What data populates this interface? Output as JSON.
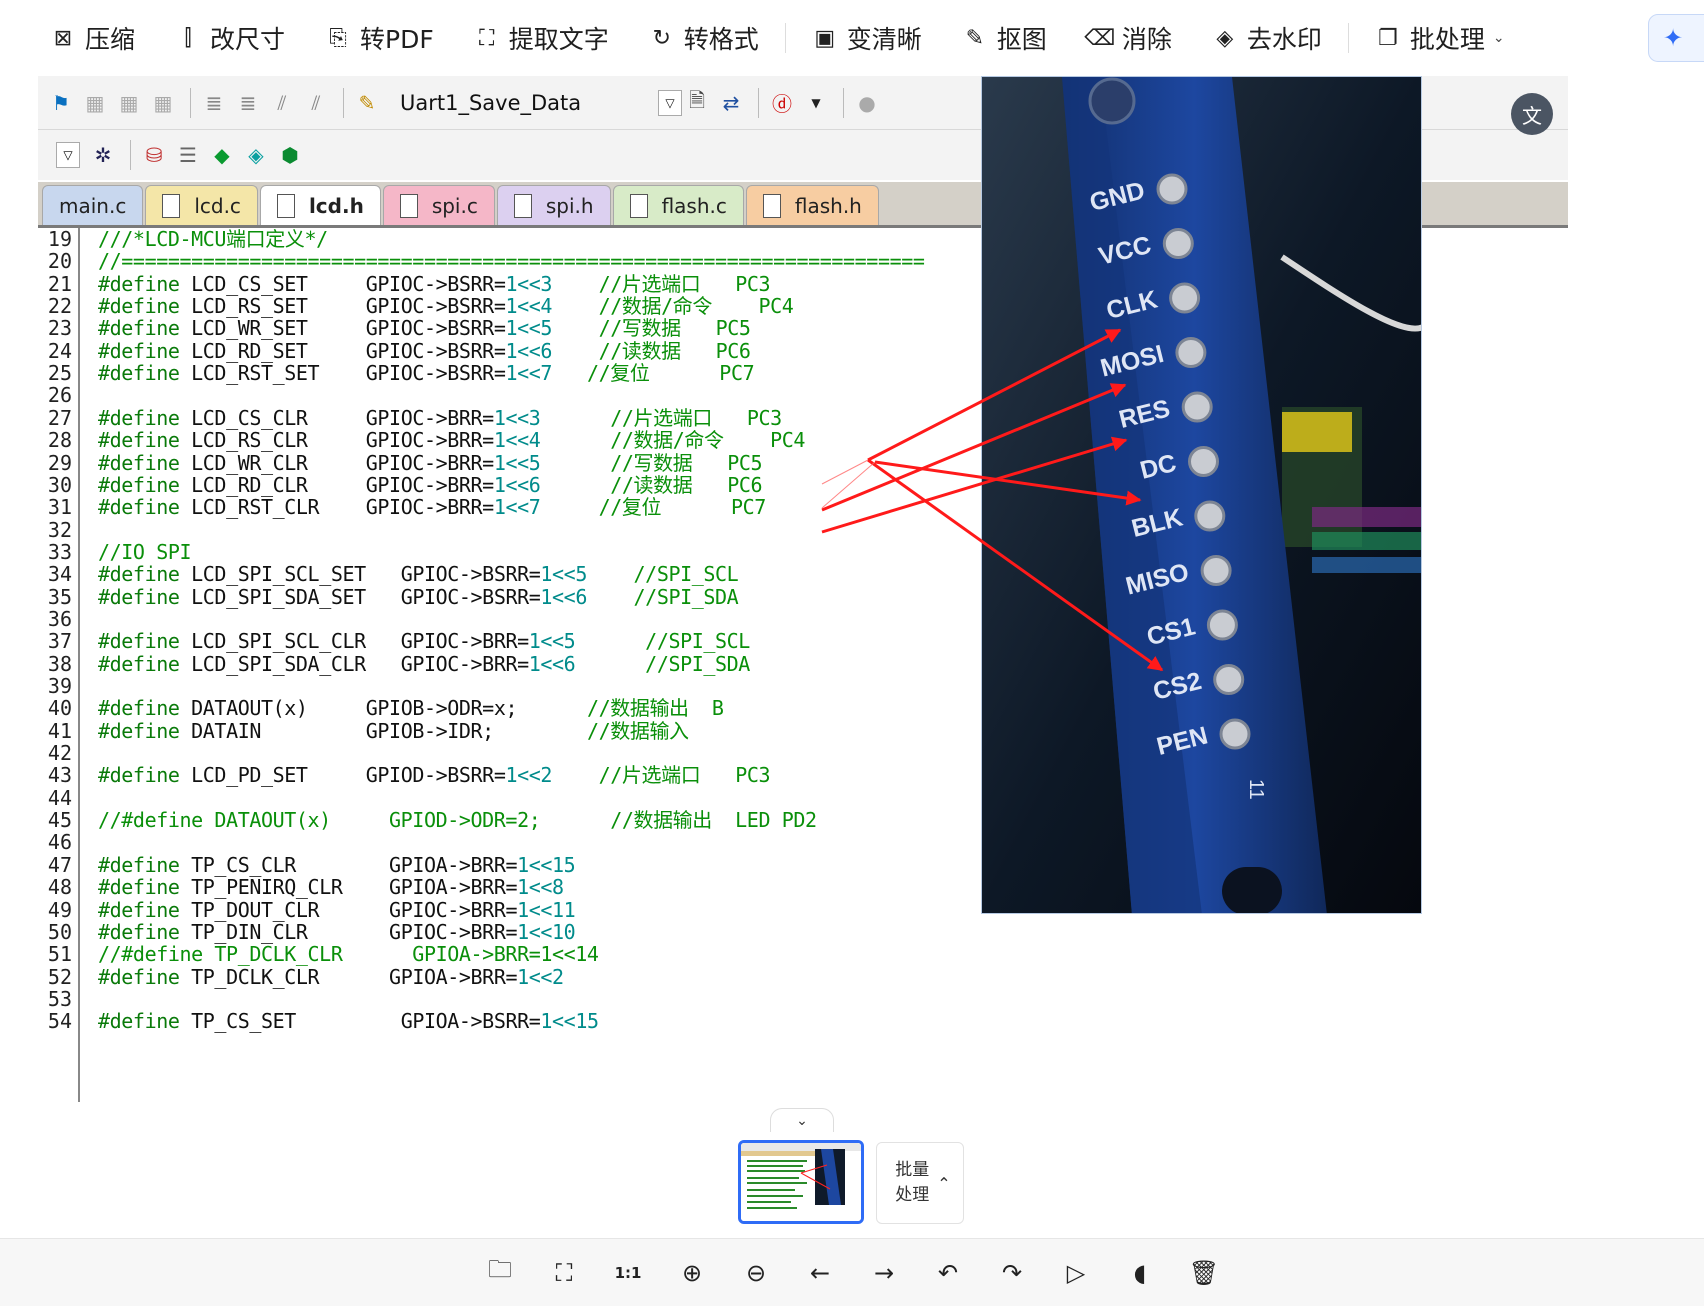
{
  "toolbar": {
    "items": [
      {
        "label": "压缩",
        "icon": "compress-icon",
        "glyph": "⊠"
      },
      {
        "label": "改尺寸",
        "icon": "resize-icon",
        "glyph": "⫿"
      },
      {
        "label": "转PDF",
        "icon": "pdf-icon",
        "glyph": "⎘"
      },
      {
        "label": "提取文字",
        "icon": "ocr-icon",
        "glyph": "⛶"
      },
      {
        "label": "转格式",
        "icon": "convert-format-icon",
        "glyph": "↻"
      },
      {
        "label": "变清晰",
        "icon": "hd-icon",
        "glyph": "▣"
      },
      {
        "label": "抠图",
        "icon": "cutout-icon",
        "glyph": "✎"
      },
      {
        "label": "消除",
        "icon": "erase-icon",
        "glyph": "⌫"
      },
      {
        "label": "去水印",
        "icon": "watermark-icon",
        "glyph": "◈"
      },
      {
        "label": "批处理",
        "icon": "batch-icon",
        "glyph": "❐"
      }
    ],
    "ai_glyph": "✦"
  },
  "ide": {
    "target_combo": "Uart1_Save_Data",
    "tabs": [
      {
        "label": "main.c",
        "color": "#c8d7ee",
        "doc": false
      },
      {
        "label": "lcd.c",
        "color": "#f4e6a8",
        "doc": true
      },
      {
        "label": "lcd.h",
        "color": "#ffffff",
        "doc": true,
        "active": true
      },
      {
        "label": "spi.c",
        "color": "#f5b7c8",
        "doc": true
      },
      {
        "label": "spi.h",
        "color": "#dcd0f0",
        "doc": true
      },
      {
        "label": "flash.c",
        "color": "#d8ebc8",
        "doc": true
      },
      {
        "label": "flash.h",
        "color": "#f7cda2",
        "doc": true
      }
    ],
    "lines": [
      {
        "n": "19",
        "t": "///*LCD-MCU端口定义*/",
        "cls": "cm"
      },
      {
        "n": "20",
        "t": "//=====================================================================",
        "cls": "cm"
      },
      {
        "n": "21",
        "k": "#define",
        "a": " LCD_CS_SET     ",
        "b": "GPIOC->BSRR=",
        "c": "1<<3",
        "d": "    //片选端口   PC3"
      },
      {
        "n": "22",
        "k": "#define",
        "a": " LCD_RS_SET     ",
        "b": "GPIOC->BSRR=",
        "c": "1<<4",
        "d": "    //数据/命令    PC4"
      },
      {
        "n": "23",
        "k": "#define",
        "a": " LCD_WR_SET     ",
        "b": "GPIOC->BSRR=",
        "c": "1<<5",
        "d": "    //写数据   PC5"
      },
      {
        "n": "24",
        "k": "#define",
        "a": " LCD_RD_SET     ",
        "b": "GPIOC->BSRR=",
        "c": "1<<6",
        "d": "    //读数据   PC6"
      },
      {
        "n": "25",
        "k": "#define",
        "a": " LCD_RST_SET    ",
        "b": "GPIOC->BSRR=",
        "c": "1<<7",
        "d": "   //复位      PC7"
      },
      {
        "n": "26",
        "t": ""
      },
      {
        "n": "27",
        "k": "#define",
        "a": " LCD_CS_CLR     ",
        "b": "GPIOC->BRR=",
        "c": "1<<3",
        "d": "      //片选端口   PC3"
      },
      {
        "n": "28",
        "k": "#define",
        "a": " LCD_RS_CLR     ",
        "b": "GPIOC->BRR=",
        "c": "1<<4",
        "d": "      //数据/命令    PC4"
      },
      {
        "n": "29",
        "k": "#define",
        "a": " LCD_WR_CLR     ",
        "b": "GPIOC->BRR=",
        "c": "1<<5",
        "d": "      //写数据   PC5"
      },
      {
        "n": "30",
        "k": "#define",
        "a": " LCD_RD_CLR     ",
        "b": "GPIOC->BRR=",
        "c": "1<<6",
        "d": "      //读数据   PC6"
      },
      {
        "n": "31",
        "k": "#define",
        "a": " LCD_RST_CLR    ",
        "b": "GPIOC->BRR=",
        "c": "1<<7",
        "d": "     //复位      PC7"
      },
      {
        "n": "32",
        "t": ""
      },
      {
        "n": "33",
        "t": "//IO SPI",
        "cls": "cm"
      },
      {
        "n": "34",
        "k": "#define",
        "a": " LCD_SPI_SCL_SET   ",
        "b": "GPIOC->BSRR=",
        "c": "1<<5",
        "d": "    //SPI_SCL"
      },
      {
        "n": "35",
        "k": "#define",
        "a": " LCD_SPI_SDA_SET   ",
        "b": "GPIOC->BSRR=",
        "c": "1<<6",
        "d": "    //SPI_SDA"
      },
      {
        "n": "36",
        "t": ""
      },
      {
        "n": "37",
        "k": "#define",
        "a": " LCD_SPI_SCL_CLR   ",
        "b": "GPIOC->BRR=",
        "c": "1<<5",
        "d": "      //SPI_SCL"
      },
      {
        "n": "38",
        "k": "#define",
        "a": " LCD_SPI_SDA_CLR   ",
        "b": "GPIOC->BRR=",
        "c": "1<<6",
        "d": "      //SPI_SDA"
      },
      {
        "n": "39",
        "t": ""
      },
      {
        "n": "40",
        "k": "#define",
        "a": " DATAOUT(x)     ",
        "b": "GPIOB->ODR=x;",
        "c": "",
        "d": "      //数据输出  B"
      },
      {
        "n": "41",
        "k": "#define",
        "a": " DATAIN         ",
        "b": "GPIOB->IDR;",
        "c": "",
        "d": "        //数据输入"
      },
      {
        "n": "42",
        "t": ""
      },
      {
        "n": "43",
        "k": "#define",
        "a": " LCD_PD_SET     ",
        "b": "GPIOD->BSRR=",
        "c": "1<<2",
        "d": "    //片选端口   PC3"
      },
      {
        "n": "44",
        "t": ""
      },
      {
        "n": "45",
        "t": "//#define DATAOUT(x)     GPIOD->ODR=2;      //数据输出  LED PD2",
        "cls": "cm"
      },
      {
        "n": "46",
        "t": ""
      },
      {
        "n": "47",
        "k": "#define",
        "a": " TP_CS_CLR        ",
        "b": "GPIOA->BRR=",
        "c": "1<<15",
        "d": ""
      },
      {
        "n": "48",
        "k": "#define",
        "a": " TP_PENIRQ_CLR    ",
        "b": "GPIOA->BRR=",
        "c": "1<<8",
        "d": ""
      },
      {
        "n": "49",
        "k": "#define",
        "a": " TP_DOUT_CLR      ",
        "b": "GPIOC->BRR=",
        "c": "1<<11",
        "d": ""
      },
      {
        "n": "50",
        "k": "#define",
        "a": " TP_DIN_CLR       ",
        "b": "GPIOC->BRR=",
        "c": "1<<10",
        "d": ""
      },
      {
        "n": "51",
        "t": "//#define TP_DCLK_CLR      GPIOA->BRR=1<<14",
        "cls": "cm"
      },
      {
        "n": "52",
        "k": "#define",
        "a": " TP_DCLK_CLR      ",
        "b": "GPIOA->BRR=",
        "c": "1<<2",
        "d": ""
      },
      {
        "n": "53",
        "t": ""
      },
      {
        "n": "54",
        "k": "#define",
        "a": " TP_CS_SET         ",
        "b": "GPIOA->BSRR=",
        "c": "1<<15",
        "d": ""
      }
    ]
  },
  "photo": {
    "pins": [
      "GND",
      "VCC",
      "CLK",
      "MOSI",
      "RES",
      "DC",
      "BLK",
      "MISO",
      "CS1",
      "CS2",
      "PEN"
    ],
    "edge_label": "11"
  },
  "float_translate_glyph": "文",
  "thumb_toggle_glyph": "⌄",
  "batch": {
    "label": "批量处理",
    "glyph": "⌃"
  },
  "bottom_icons": [
    {
      "name": "open-folder-icon",
      "glyph": "🗀"
    },
    {
      "name": "fullscreen-icon",
      "glyph": "⛶"
    },
    {
      "name": "actual-size-icon",
      "glyph": "1:1"
    },
    {
      "name": "zoom-in-icon",
      "glyph": "⊕"
    },
    {
      "name": "zoom-out-icon",
      "glyph": "⊖"
    },
    {
      "name": "previous-icon",
      "glyph": "←"
    },
    {
      "name": "next-icon",
      "glyph": "→"
    },
    {
      "name": "rotate-left-icon",
      "glyph": "↶"
    },
    {
      "name": "rotate-right-icon",
      "glyph": "↷"
    },
    {
      "name": "slideshow-icon",
      "glyph": "▷"
    },
    {
      "name": "mouse-icon",
      "glyph": "◖"
    },
    {
      "name": "delete-icon",
      "glyph": "🗑"
    }
  ],
  "colors": {
    "accent": "#2f6cf6",
    "arrow": "#ff1a1a",
    "pcb": "#1a3c8a"
  }
}
